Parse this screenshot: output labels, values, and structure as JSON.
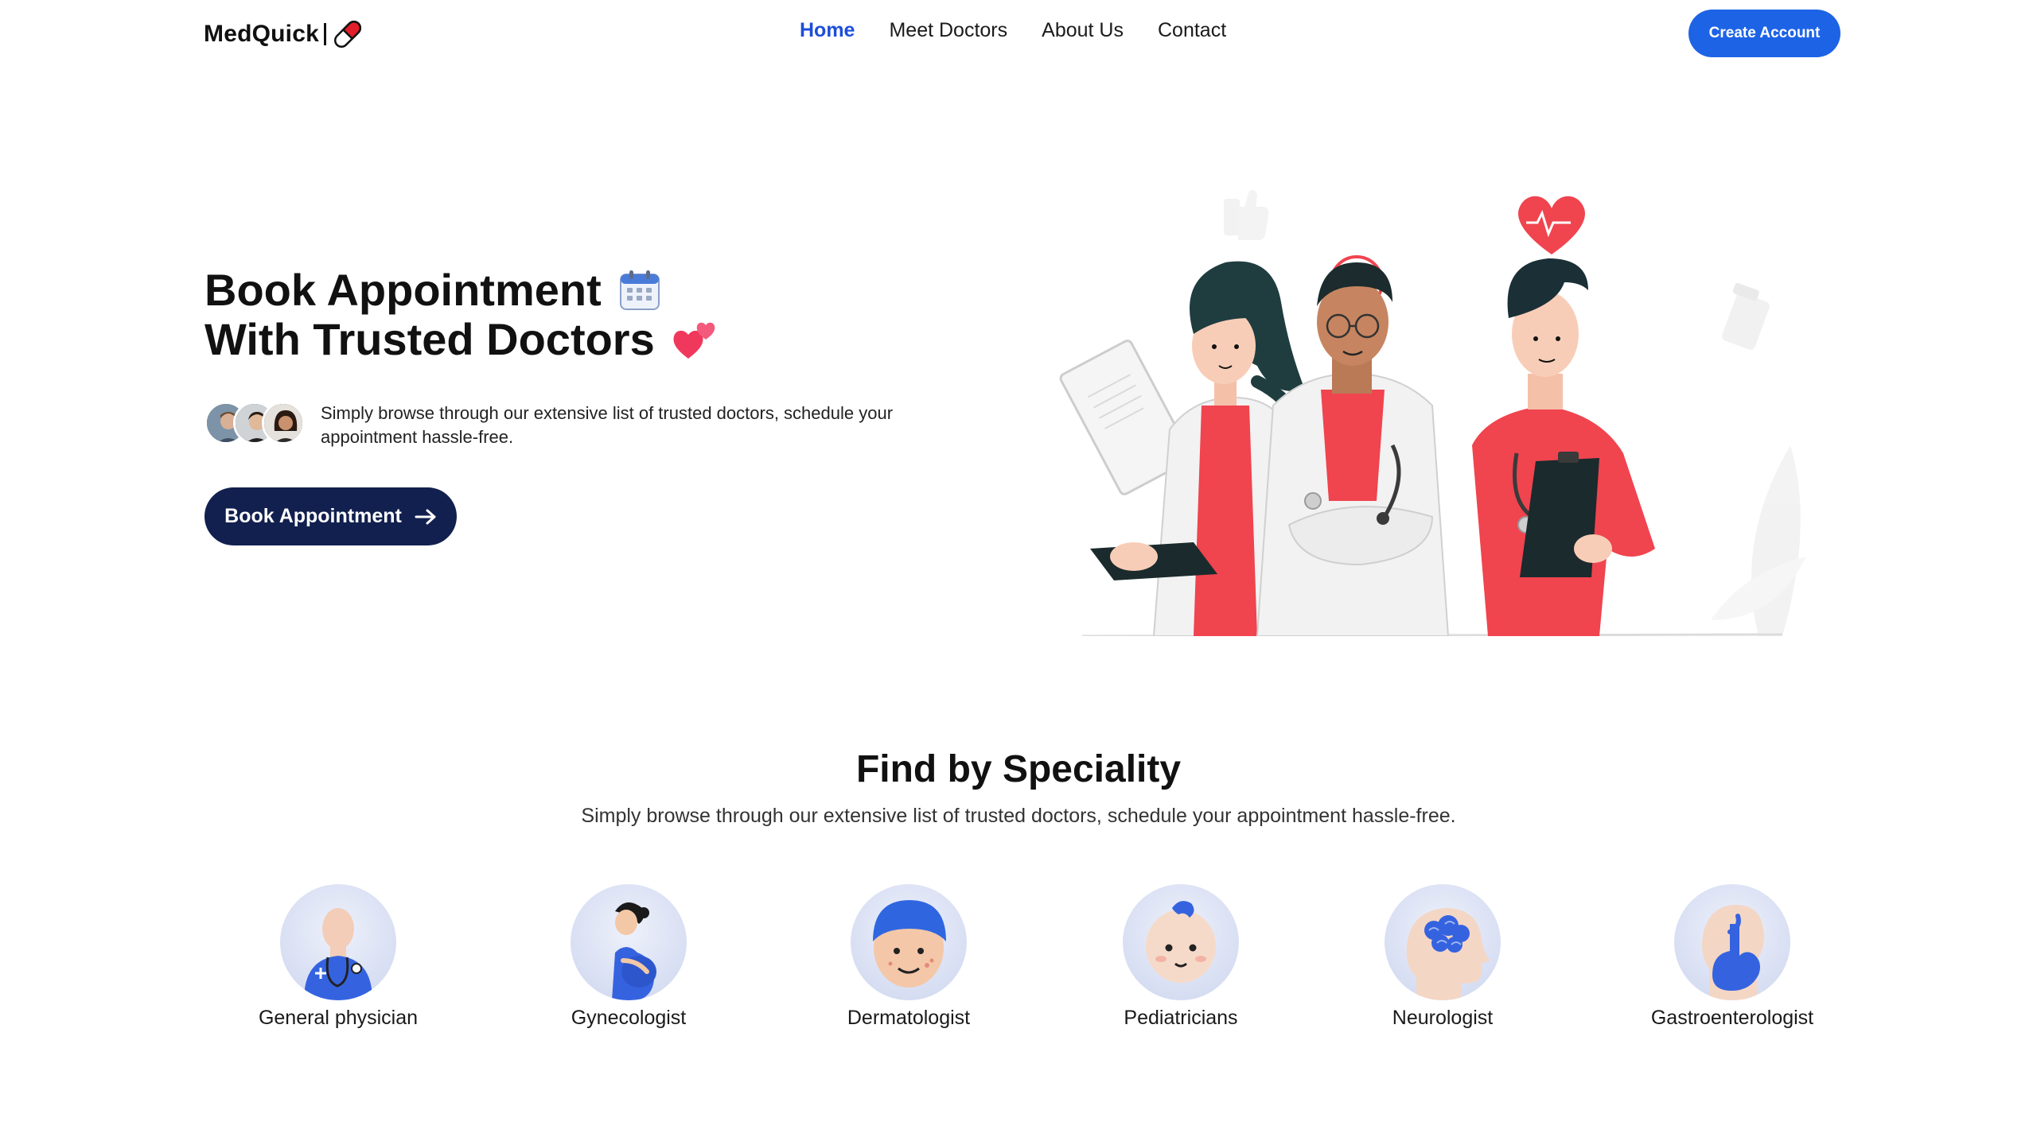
{
  "navbar": {
    "logo_text": "MedQuick",
    "links": [
      {
        "label": "Home",
        "active": true
      },
      {
        "label": "Meet Doctors",
        "active": false
      },
      {
        "label": "About Us",
        "active": false
      },
      {
        "label": "Contact",
        "active": false
      }
    ],
    "create_account_label": "Create Account"
  },
  "hero": {
    "title_line1": "Book Appointment",
    "title_line2": "With Trusted Doctors",
    "title_line1_icon": "calendar-icon",
    "title_line2_icon": "two-hearts-icon",
    "description": "Simply browse through our extensive list of trusted doctors, schedule your appointment hassle-free.",
    "book_button_label": "Book Appointment",
    "book_button_icon": "arrow-right-icon"
  },
  "speciality": {
    "title": "Find by Speciality",
    "subtitle": "Simply browse through our extensive list of trusted doctors, schedule your appointment hassle-free.",
    "items": [
      {
        "label": "General physician",
        "icon": "general-physician-icon"
      },
      {
        "label": "Gynecologist",
        "icon": "gynecologist-icon"
      },
      {
        "label": "Dermatologist",
        "icon": "dermatologist-icon"
      },
      {
        "label": "Pediatricians",
        "icon": "pediatrician-icon"
      },
      {
        "label": "Neurologist",
        "icon": "neurologist-icon"
      },
      {
        "label": "Gastroenterologist",
        "icon": "gastroenterologist-icon"
      }
    ]
  },
  "colors": {
    "accent": "#1d63e6",
    "active_link": "#1d4ed8",
    "dark_button": "#12204f",
    "illustration_red": "#f0444f"
  }
}
